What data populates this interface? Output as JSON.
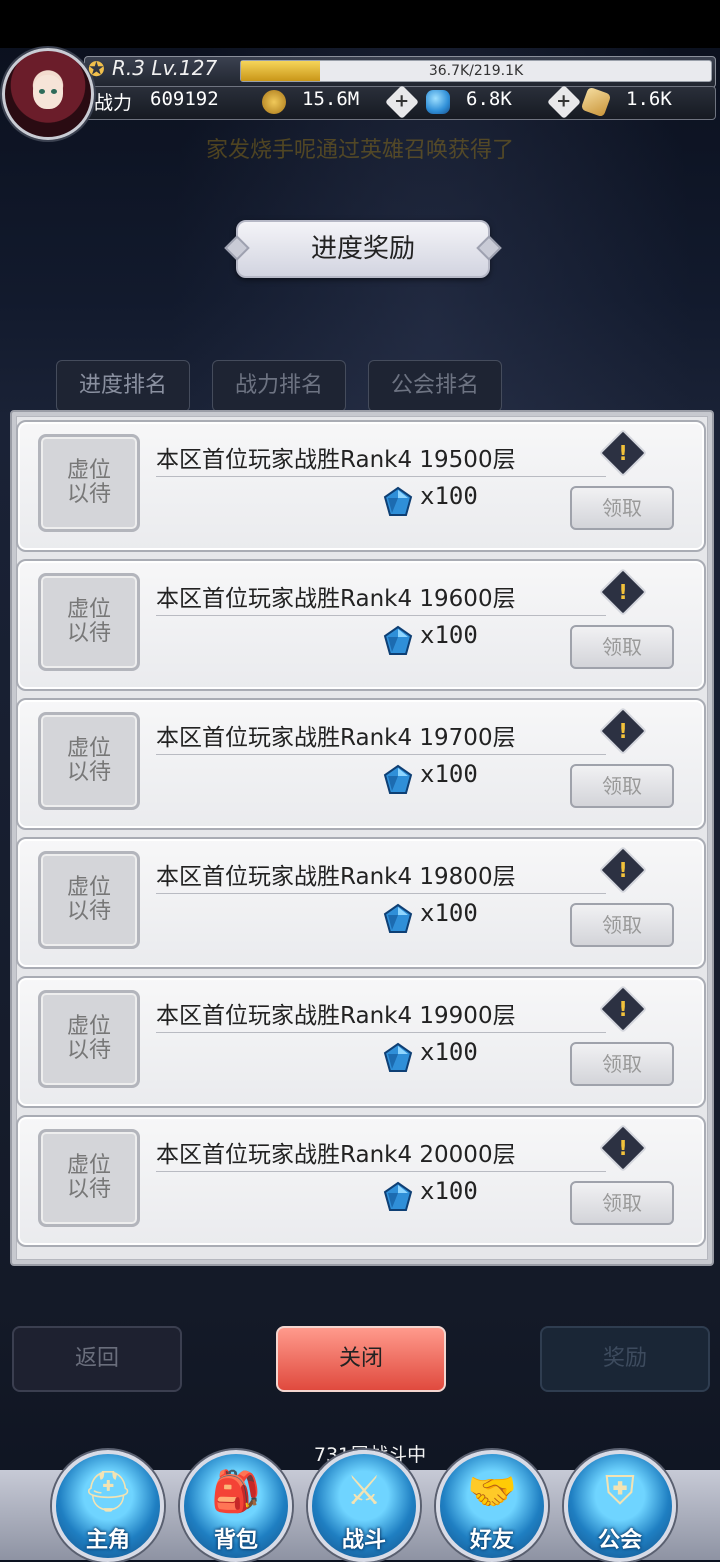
{
  "hud": {
    "rank_level": "R.3 Lv.127",
    "exp_text": "36.7K/219.1K",
    "exp_progress": 0.1675,
    "power_label": "战力",
    "power_value": "609192",
    "gold": "15.6M",
    "gems": "6.8K",
    "crystal": "1.6K",
    "icons": {
      "avatar": "avatar",
      "level_badge": "star-icon",
      "gold": "gold-coin-icon",
      "gem": "gem-icon",
      "crystal": "crystal-icon",
      "plus": "plus-icon"
    }
  },
  "marquee": "家发烧手呢通过英雄召唤获得了",
  "title": "进度奖励",
  "tabs": [
    "进度排名",
    "战力排名",
    "公会排名"
  ],
  "rewards": [
    {
      "placeholder": [
        "虚位",
        "以待"
      ],
      "title": "本区首位玩家战胜Rank4 19500层",
      "qty": "x100",
      "claim": "领取"
    },
    {
      "placeholder": [
        "虚位",
        "以待"
      ],
      "title": "本区首位玩家战胜Rank4 19600层",
      "qty": "x100",
      "claim": "领取"
    },
    {
      "placeholder": [
        "虚位",
        "以待"
      ],
      "title": "本区首位玩家战胜Rank4 19700层",
      "qty": "x100",
      "claim": "领取"
    },
    {
      "placeholder": [
        "虚位",
        "以待"
      ],
      "title": "本区首位玩家战胜Rank4 19800层",
      "qty": "x100",
      "claim": "领取"
    },
    {
      "placeholder": [
        "虚位",
        "以待"
      ],
      "title": "本区首位玩家战胜Rank4 19900层",
      "qty": "x100",
      "claim": "领取"
    },
    {
      "placeholder": [
        "虚位",
        "以待"
      ],
      "title": "本区首位玩家战胜Rank4 20000层",
      "qty": "x100",
      "claim": "领取"
    }
  ],
  "buttons": {
    "back": "返回",
    "close": "关闭",
    "reward": "奖励"
  },
  "status": "731层战斗中",
  "nav": [
    "主角",
    "背包",
    "战斗",
    "好友",
    "公会"
  ],
  "colors": {
    "accent_red": "#e04a3e",
    "gem_blue": "#2f8fd8",
    "gold": "#f1c04c"
  }
}
